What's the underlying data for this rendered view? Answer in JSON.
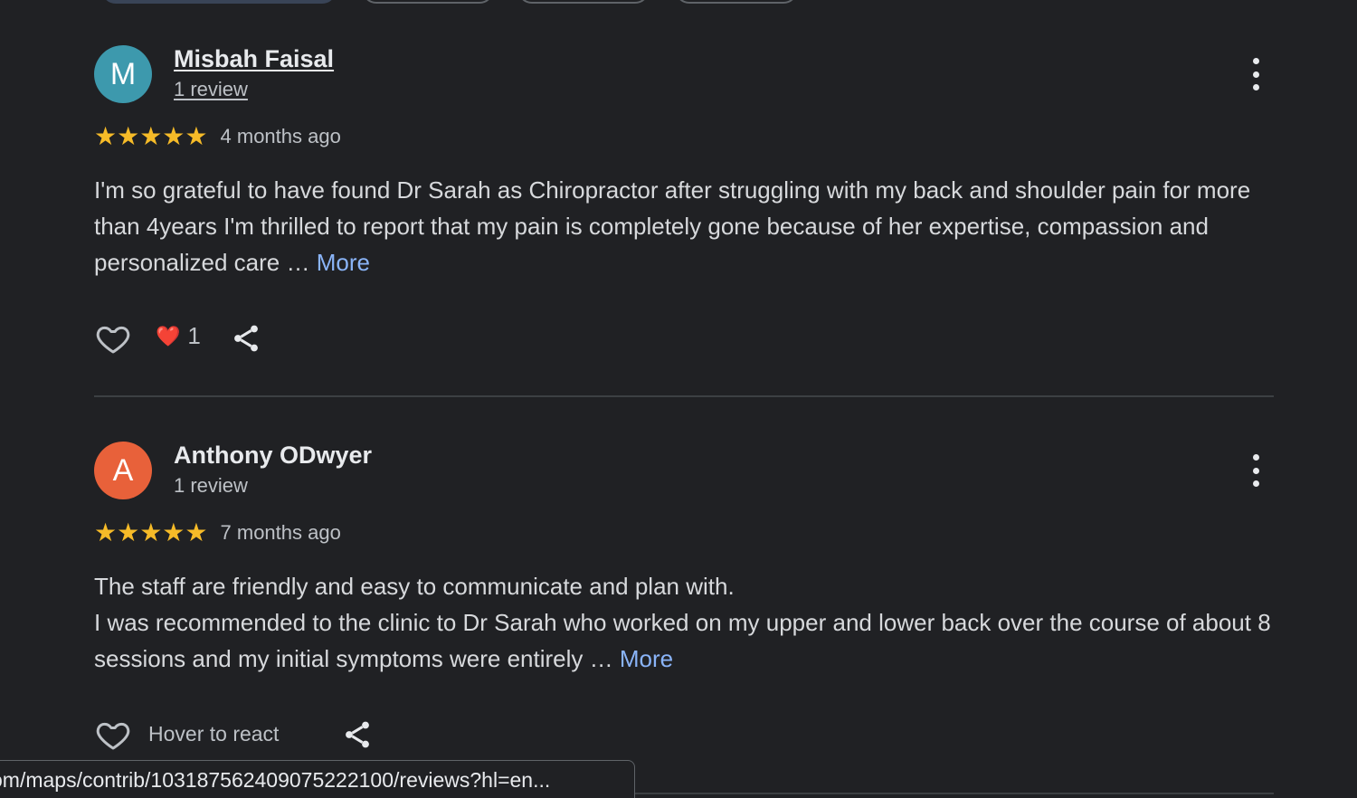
{
  "filter_chips": 4,
  "colors": {
    "background": "#202124",
    "star": "#f6bb28",
    "link": "#8ab4f8",
    "heart_emoji": "#ea4335"
  },
  "reviews": [
    {
      "avatar_letter": "M",
      "avatar_color": "#3d99ad",
      "name": "Misbah Faisal",
      "review_count": "1 review",
      "stars": "★★★★★",
      "rating": 5,
      "time_ago": "4 months ago",
      "text_lines": [
        "I'm so grateful to have found Dr Sarah as Chiropractor after struggling with my back and shoulder pain for more than 4years I'm thrilled to report that my pain is completely gone because of her expertise, compassion and personalized care …"
      ],
      "more_label": "More",
      "reaction_emoji": "❤️",
      "reaction_count": "1",
      "icons": [
        "heart-outline-icon",
        "share-icon",
        "more-vert-icon"
      ]
    },
    {
      "avatar_letter": "A",
      "avatar_color": "#e8613a",
      "name": "Anthony ODwyer",
      "review_count": "1 review",
      "stars": "★★★★★",
      "rating": 5,
      "time_ago": "7 months ago",
      "text_lines": [
        "The staff are friendly and easy to communicate and plan with.",
        "I was recommended to the clinic to Dr Sarah who worked on my upper and lower back over the course of about 8 sessions and my initial symptoms were entirely …"
      ],
      "more_label": "More",
      "hover_label": "Hover to react",
      "icons": [
        "heart-outline-icon",
        "share-icon",
        "more-vert-icon"
      ]
    }
  ],
  "status_bar": {
    "url": "om/maps/contrib/103187562409075222100/reviews?hl=en..."
  }
}
